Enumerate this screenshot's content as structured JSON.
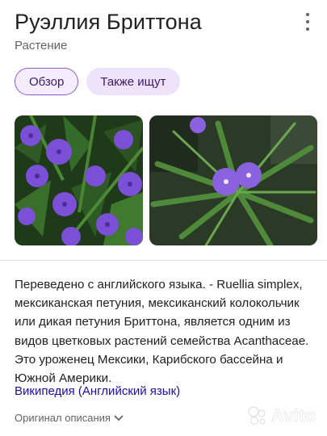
{
  "header": {
    "title": "Руэллия Бриттона",
    "subtitle": "Растение",
    "menu_icon": "more-vert-icon"
  },
  "chips": [
    {
      "label": "Обзор",
      "active": true
    },
    {
      "label": "Также ищут",
      "active": false
    }
  ],
  "gallery": {
    "images": [
      "purple-flowers-bush",
      "purple-flowers-closeup"
    ]
  },
  "description": {
    "text": "Переведено с английского языка. - Ruellia simplex, мексиканская петуния, мексиканский колокольчик или дикая петуния Бриттона, является одним из видов цветковых растений семейства Acanthaceae. Это уроженец Мексики, Карибского бассейна и Южной Америки.",
    "source_link": "Википедия (Английский язык)",
    "original_label": "Оригинал описания"
  },
  "watermark": {
    "text": "Avito"
  },
  "colors": {
    "chip_border": "#8e5cc9",
    "chip_bg": "#efe3fb",
    "link": "#1a0dab",
    "flower": "#7b4fd6"
  }
}
